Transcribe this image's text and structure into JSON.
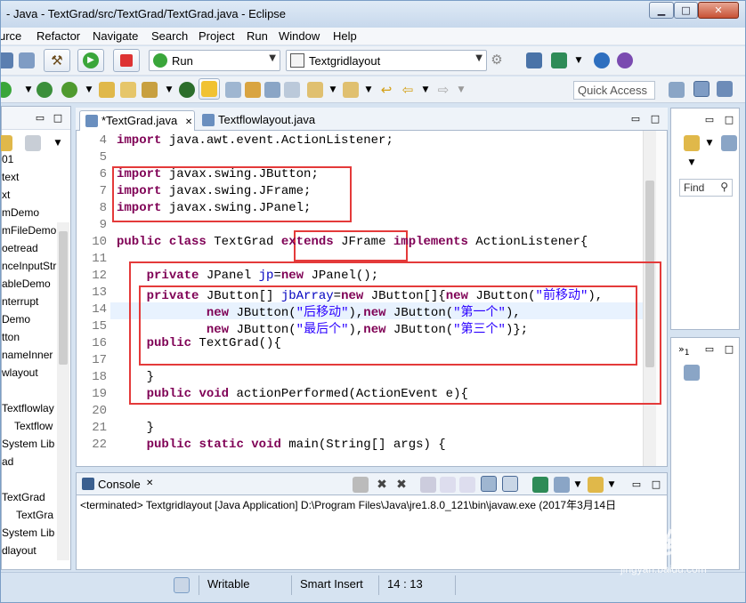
{
  "window": {
    "title": "- Java - TextGrad/src/TextGrad/TextGrad.java - Eclipse",
    "minimize": "▁",
    "maximize": "□",
    "close": "✕"
  },
  "menu": [
    "urce",
    "Refactor",
    "Navigate",
    "Search",
    "Project",
    "Run",
    "Window",
    "Help"
  ],
  "toolbar": {
    "run_config": "Run",
    "launch_config": "Textgridlayout",
    "quick_access_placeholder": "Quick Access"
  },
  "left_panel": {
    "items": [
      "01",
      "text",
      "xt",
      "mDemo",
      "mFileDemo",
      "oetread",
      "nceInputStr",
      "ableDemo",
      "nterrupt",
      "Demo",
      "tton",
      "nameInner",
      "wlayout",
      "Textflowlay",
      "Textflow",
      "System Lib",
      "ad",
      "TextGrad",
      "TextGra",
      "System Lib",
      "dlayout"
    ]
  },
  "editor": {
    "tabs": [
      {
        "label": "*TextGrad.java",
        "close": "✕"
      },
      {
        "label": "Textflowlayout.java"
      }
    ],
    "lines": [
      {
        "n": "4",
        "tokens": [
          {
            "t": "import",
            "c": "kw"
          },
          {
            "t": " java.awt.event.ActionListener;"
          }
        ]
      },
      {
        "n": "5",
        "tokens": []
      },
      {
        "n": "6",
        "tokens": [
          {
            "t": "import",
            "c": "kw"
          },
          {
            "t": " javax.swing.JButton;"
          }
        ]
      },
      {
        "n": "7",
        "tokens": [
          {
            "t": "import",
            "c": "kw"
          },
          {
            "t": " javax.swing.JFrame;"
          }
        ]
      },
      {
        "n": "8",
        "tokens": [
          {
            "t": "import",
            "c": "kw"
          },
          {
            "t": " javax.swing.JPanel;"
          }
        ]
      },
      {
        "n": "9",
        "tokens": []
      },
      {
        "n": "10",
        "tokens": [
          {
            "t": "public",
            "c": "kw"
          },
          {
            "t": " "
          },
          {
            "t": "class",
            "c": "kw"
          },
          {
            "t": " TextGrad "
          },
          {
            "t": "extends",
            "c": "kw"
          },
          {
            "t": " JFrame "
          },
          {
            "t": "implements",
            "c": "kw"
          },
          {
            "t": " ActionListener{"
          }
        ]
      },
      {
        "n": "11",
        "tokens": []
      },
      {
        "n": "12",
        "tokens": [
          {
            "t": "    "
          },
          {
            "t": "private",
            "c": "kw"
          },
          {
            "t": " JPanel "
          },
          {
            "t": "jp",
            "c": "fld"
          },
          {
            "t": "="
          },
          {
            "t": "new",
            "c": "kw"
          },
          {
            "t": " JPanel();"
          }
        ]
      },
      {
        "n": "13",
        "tokens": [
          {
            "t": "    "
          },
          {
            "t": "private",
            "c": "kw"
          },
          {
            "t": " JButton[] "
          },
          {
            "t": "jbArray",
            "c": "fld"
          },
          {
            "t": "="
          },
          {
            "t": "new",
            "c": "kw"
          },
          {
            "t": " JButton[]{"
          },
          {
            "t": "new",
            "c": "kw"
          },
          {
            "t": " JButton("
          },
          {
            "t": "\"前移动\"",
            "c": "str"
          },
          {
            "t": "),"
          }
        ]
      },
      {
        "n": "14",
        "tokens": [
          {
            "t": "            "
          },
          {
            "t": "new",
            "c": "kw"
          },
          {
            "t": " JButton("
          },
          {
            "t": "\"后移动\"",
            "c": "str"
          },
          {
            "t": "),"
          },
          {
            "t": "new",
            "c": "kw"
          },
          {
            "t": " JButton("
          },
          {
            "t": "\"第一个\"",
            "c": "str"
          },
          {
            "t": "),"
          }
        ]
      },
      {
        "n": "15",
        "tokens": [
          {
            "t": "            "
          },
          {
            "t": "new",
            "c": "kw"
          },
          {
            "t": " JButton("
          },
          {
            "t": "\"最后个\"",
            "c": "str"
          },
          {
            "t": "),"
          },
          {
            "t": "new",
            "c": "kw"
          },
          {
            "t": " JButton("
          },
          {
            "t": "\"第三个\"",
            "c": "str"
          },
          {
            "t": ")};"
          }
        ]
      },
      {
        "n": "16",
        "tokens": [
          {
            "t": "    "
          },
          {
            "t": "public",
            "c": "kw"
          },
          {
            "t": " TextGrad(){"
          }
        ]
      },
      {
        "n": "17",
        "tokens": []
      },
      {
        "n": "18",
        "tokens": [
          {
            "t": "    }"
          }
        ]
      },
      {
        "n": "19",
        "tokens": [
          {
            "t": "    "
          },
          {
            "t": "public",
            "c": "kw"
          },
          {
            "t": " "
          },
          {
            "t": "void",
            "c": "kw"
          },
          {
            "t": " actionPerformed(ActionEvent e){"
          }
        ]
      },
      {
        "n": "20",
        "tokens": []
      },
      {
        "n": "21",
        "tokens": [
          {
            "t": "    }"
          }
        ]
      },
      {
        "n": "22",
        "tokens": [
          {
            "t": "    "
          },
          {
            "t": "public",
            "c": "kw"
          },
          {
            "t": " "
          },
          {
            "t": "static",
            "c": "kw"
          },
          {
            "t": " "
          },
          {
            "t": "void",
            "c": "kw"
          },
          {
            "t": " main(String[] args) {"
          }
        ]
      }
    ]
  },
  "right_panel": {
    "find_label": "Find",
    "badge": "1"
  },
  "console": {
    "tab_label": "Console",
    "close": "✕",
    "output": "<terminated> Textgridlayout [Java Application] D:\\Program Files\\Java\\jre1.8.0_121\\bin\\javaw.exe (2017年3月14日 "
  },
  "status": {
    "writable": "Writable",
    "insert_mode": "Smart Insert",
    "position": "14 : 13"
  },
  "watermark": {
    "brand": "Baidu经验",
    "url": "jingyan.baidu.com"
  },
  "colors": {
    "keyword": "#7f0055",
    "string": "#2a00ff",
    "field": "#0000c0",
    "annotation_box": "#e43a3a"
  }
}
